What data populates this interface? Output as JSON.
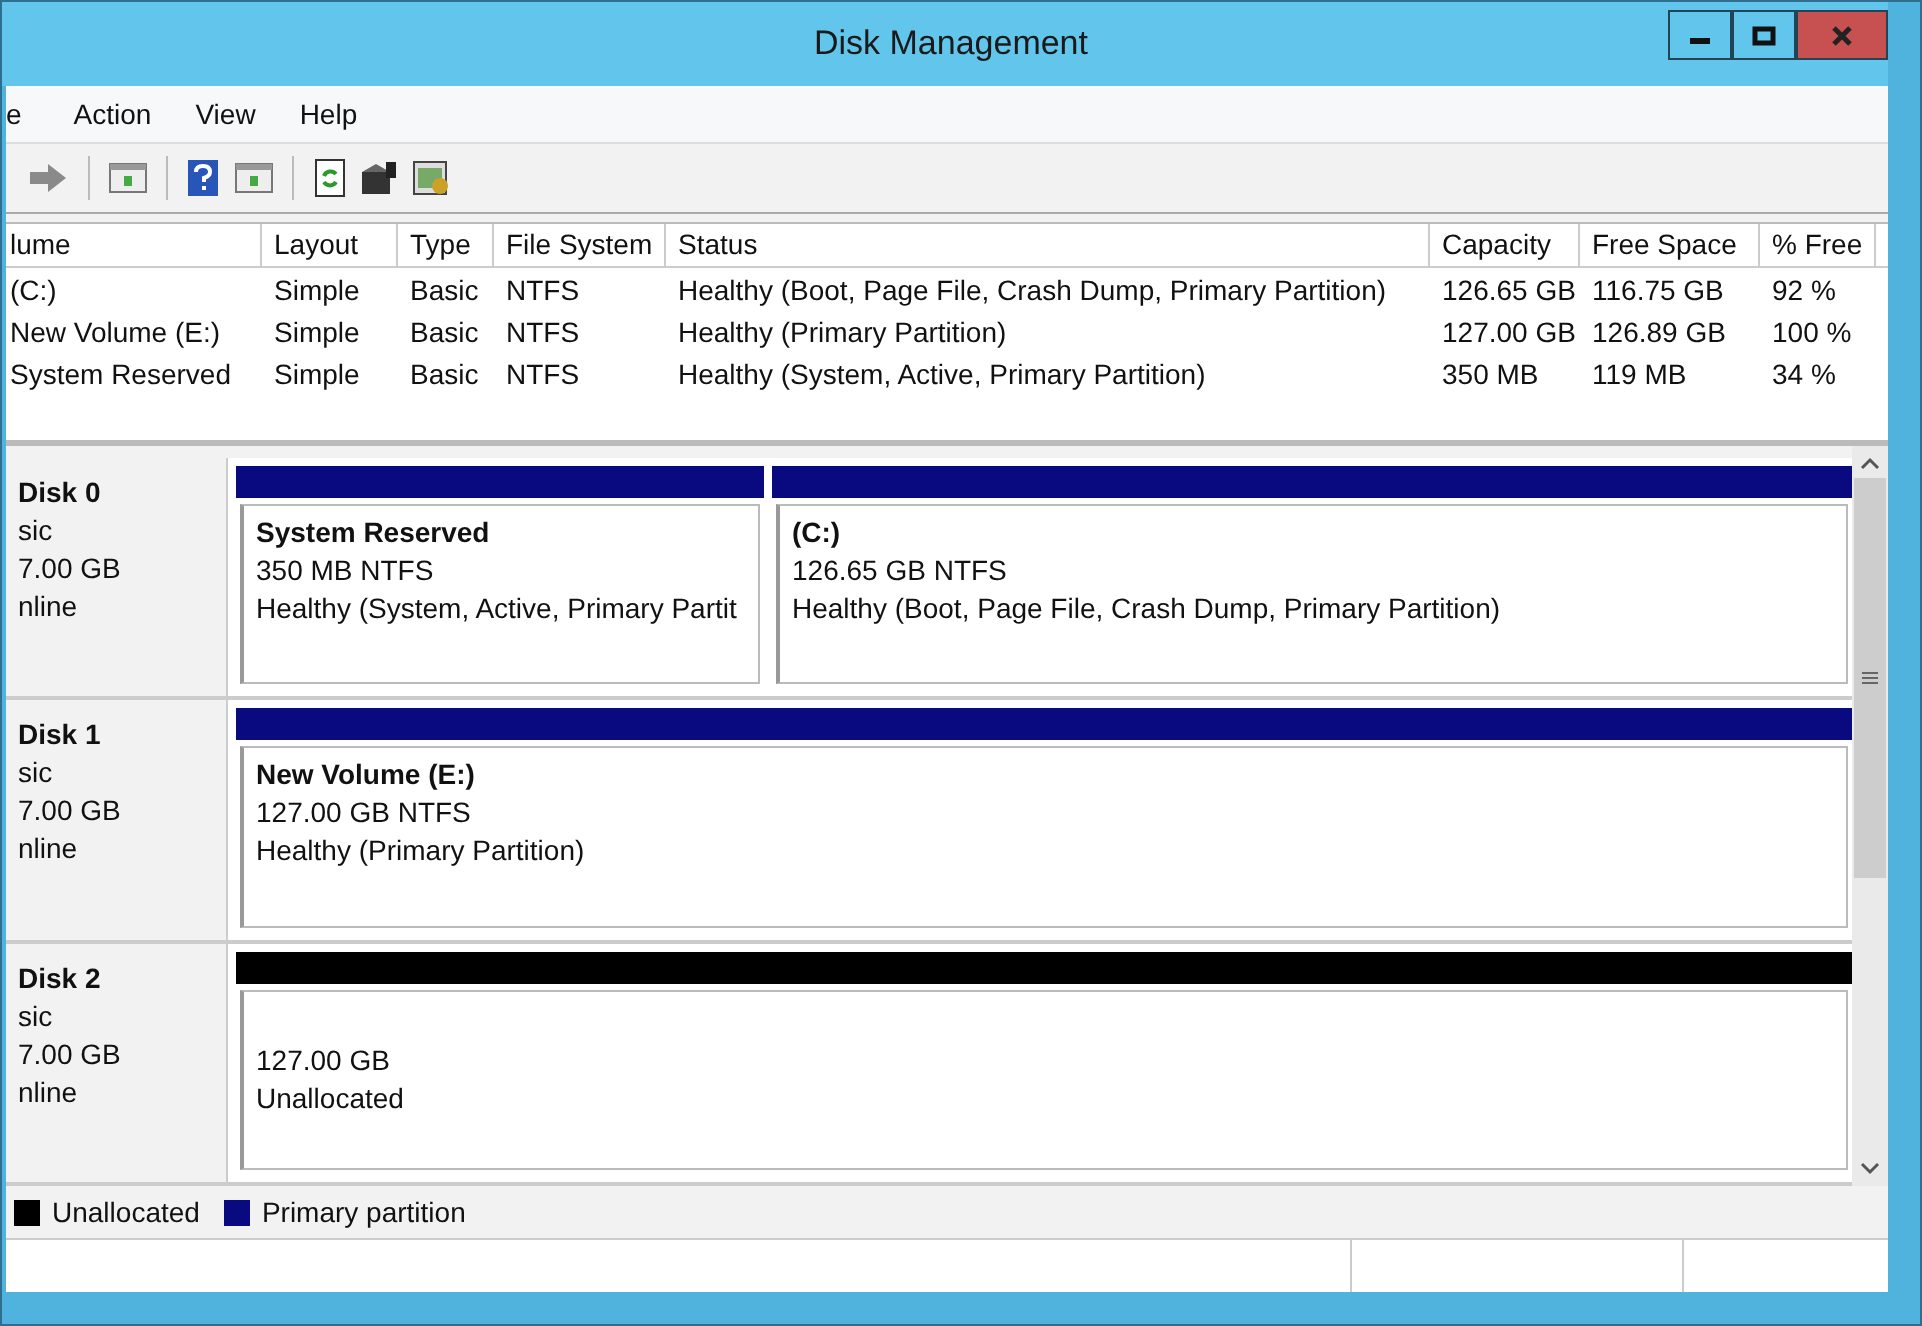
{
  "window": {
    "title": "Disk Management"
  },
  "menu": [
    {
      "label": "e"
    },
    {
      "label": "Action"
    },
    {
      "label": "View"
    },
    {
      "label": "Help"
    }
  ],
  "volumes": {
    "columns": [
      "lume",
      "Layout",
      "Type",
      "File System",
      "Status",
      "Capacity",
      "Free Space",
      "% Free"
    ],
    "rows": [
      [
        "(C:)",
        "Simple",
        "Basic",
        "NTFS",
        "Healthy (Boot, Page File, Crash Dump, Primary Partition)",
        "126.65 GB",
        "116.75 GB",
        "92 %"
      ],
      [
        "New Volume (E:)",
        "Simple",
        "Basic",
        "NTFS",
        "Healthy (Primary Partition)",
        "127.00 GB",
        "126.89 GB",
        "100 %"
      ],
      [
        "System Reserved",
        "Simple",
        "Basic",
        "NTFS",
        "Healthy (System, Active, Primary Partition)",
        "350 MB",
        "119 MB",
        "34 %"
      ]
    ]
  },
  "disks": [
    {
      "name": "Disk 0",
      "type": "sic",
      "size": "7.00 GB",
      "status": "nline",
      "partitions": [
        {
          "kind": "primary",
          "title": "System Reserved",
          "size": "350 MB NTFS",
          "status": "Healthy (System, Active, Primary Partit"
        },
        {
          "kind": "primary",
          "title": "(C:)",
          "size": "126.65 GB NTFS",
          "status": "Healthy (Boot, Page File, Crash Dump, Primary Partition)"
        }
      ]
    },
    {
      "name": "Disk 1",
      "type": "sic",
      "size": "7.00 GB",
      "status": "nline",
      "partitions": [
        {
          "kind": "primary",
          "title": "New Volume  (E:)",
          "size": "127.00 GB NTFS",
          "status": "Healthy (Primary Partition)"
        }
      ]
    },
    {
      "name": "Disk 2",
      "type": "sic",
      "size": "7.00 GB",
      "status": "nline",
      "partitions": [
        {
          "kind": "unallocated",
          "size": "127.00 GB",
          "status": "Unallocated"
        }
      ]
    }
  ],
  "legend": [
    {
      "kind": "unallocated",
      "label": "Unallocated"
    },
    {
      "kind": "primary",
      "label": "Primary partition"
    }
  ]
}
